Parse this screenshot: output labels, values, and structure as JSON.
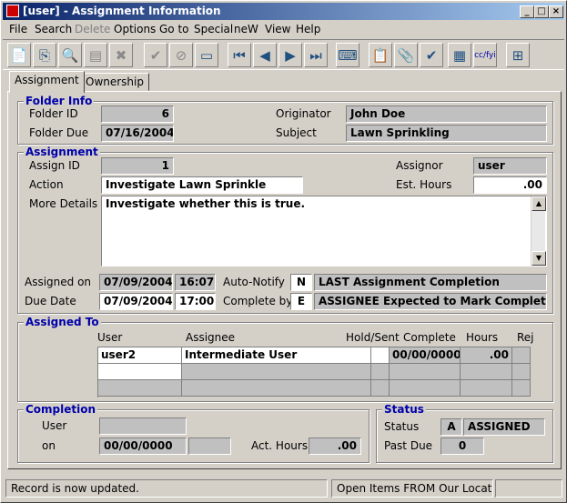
{
  "window": {
    "title": "[user] - Assignment Information"
  },
  "menu": {
    "items": [
      "File",
      "Search",
      "Delete",
      "Options",
      "Go to",
      "Special",
      "neW",
      "View",
      "Help"
    ]
  },
  "toolbar": {
    "icons": [
      "new-doc-icon",
      "copy-doc-icon",
      "preview-icon",
      "print-preview-icon",
      "delete-x-icon",
      "check-icon",
      "cancel-circle-icon",
      "printer-icon",
      "first-record-icon",
      "prev-record-icon",
      "next-record-icon",
      "last-record-icon",
      "keyboard-icon",
      "notepad-icon",
      "attach-clip-icon",
      "approve-icon",
      "form-icon",
      "cc-fyi-icon",
      "hierarchy-icon"
    ],
    "cc_label": "cc/fyi"
  },
  "tabs": [
    "Assignment",
    "Ownership"
  ],
  "folder_info": {
    "title": "Folder Info",
    "folder_id_label": "Folder ID",
    "folder_id": "6",
    "folder_due_label": "Folder Due",
    "folder_due": "07/16/2004",
    "originator_label": "Originator",
    "originator": "John Doe",
    "subject_label": "Subject",
    "subject": "Lawn Sprinkling"
  },
  "assignment": {
    "title": "Assignment",
    "assign_id_label": "Assign ID",
    "assign_id": "1",
    "assignor_label": "Assignor",
    "assignor": "user",
    "action_label": "Action",
    "action": "Investigate Lawn Sprinkle",
    "est_hours_label": "Est. Hours",
    "est_hours": ".00",
    "details_label": "More Details",
    "details": "Investigate whether this is true.",
    "assigned_on_label": "Assigned on",
    "assigned_on_date": "07/09/2004",
    "assigned_on_time": "16:07",
    "auto_notify_label": "Auto-Notify",
    "auto_notify_code": "N",
    "auto_notify_text": "LAST Assignment Completion",
    "due_date_label": "Due Date",
    "due_date": "07/09/2004",
    "due_time": "17:00",
    "complete_by_label": "Complete by",
    "complete_by_code": "E",
    "complete_by_text": "ASSIGNEE Expected to Mark Complete"
  },
  "assigned_to": {
    "title": "Assigned To",
    "columns": [
      "User",
      "Assignee",
      "Hold/Sent",
      "Complete",
      "Hours",
      "Rej"
    ],
    "rows": [
      {
        "user": "user2",
        "assignee": "Intermediate User",
        "hold": "",
        "complete": "00/00/0000",
        "hours": ".00",
        "rej": ""
      }
    ]
  },
  "completion": {
    "title": "Completion",
    "user_label": "User",
    "user": "",
    "on_label": "on",
    "on_date": "00/00/0000",
    "on_time": "",
    "act_hours_label": "Act. Hours",
    "act_hours": ".00"
  },
  "status": {
    "title": "Status",
    "status_label": "Status",
    "status_code": "A",
    "status_text": "ASSIGNED",
    "past_due_label": "Past Due",
    "past_due": "0"
  },
  "statusbar": {
    "message": "Record is now updated.",
    "location": "Open Items FROM Our Locatio"
  }
}
